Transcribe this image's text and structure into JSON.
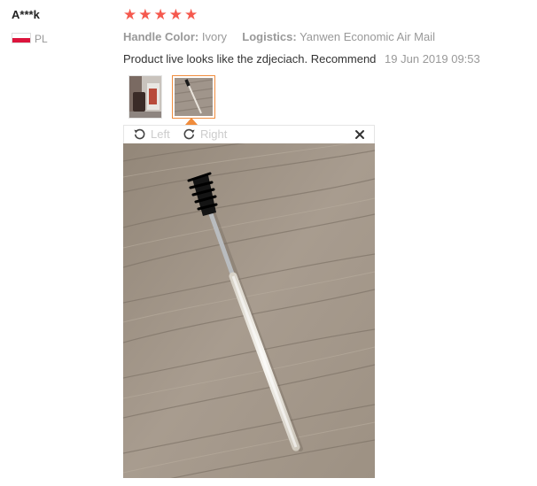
{
  "review": {
    "reviewer_name": "A***k",
    "country_code": "PL",
    "rating": 5,
    "star_glyph": "★",
    "attributes": [
      {
        "key": "Handle Color:",
        "value": "Ivory"
      },
      {
        "key": "Logistics:",
        "value": "Yanwen Economic Air Mail"
      }
    ],
    "text": "Product live looks like the zdjeciach. Recommend",
    "date": "19 Jun 2019 09:53"
  },
  "viewer": {
    "rotate_left_label": "Left",
    "rotate_right_label": "Right",
    "rotate_left_icon": "rotate-left-icon",
    "rotate_right_icon": "rotate-right-icon",
    "close_icon": "close-icon",
    "selected_thumbnail": 2
  },
  "colors": {
    "star": "#f5594e",
    "thumbnail_active_border": "#f08c3c",
    "muted_text": "#999999"
  }
}
